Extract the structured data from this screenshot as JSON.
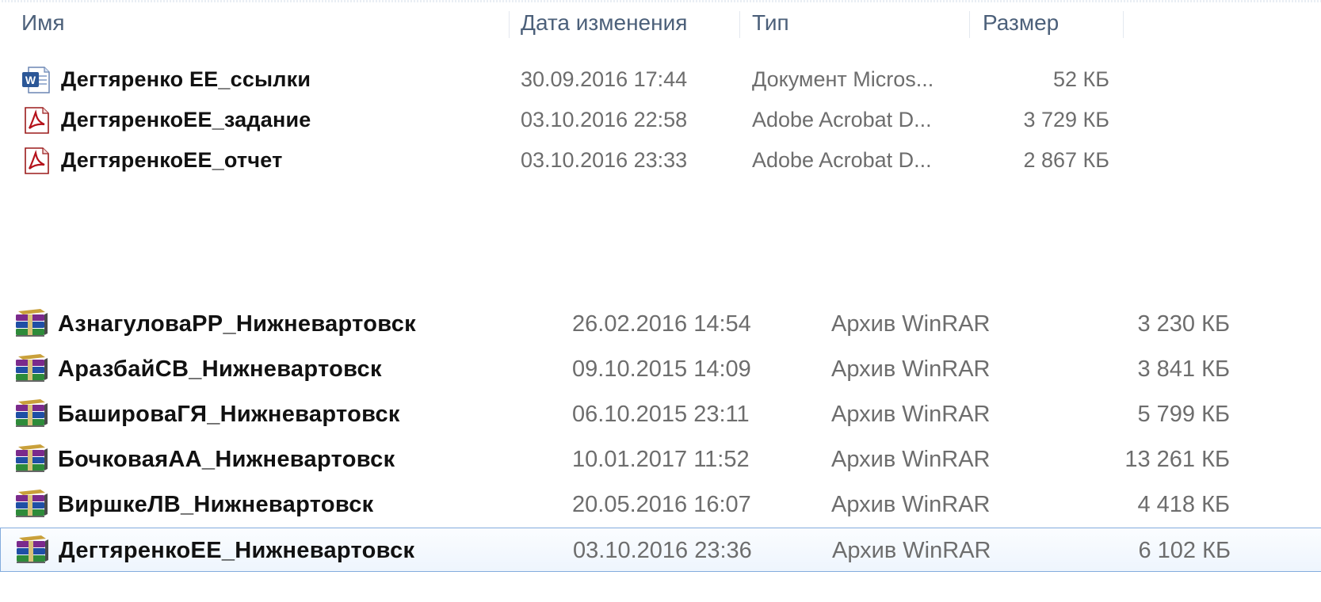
{
  "columns": {
    "name": "Имя",
    "date": "Дата изменения",
    "type": "Тип",
    "size": "Размер"
  },
  "top_files": [
    {
      "icon": "word-doc-icon",
      "name": "Дегтяренко ЕЕ_ссылки",
      "date": "30.09.2016 17:44",
      "type": "Документ Micros...",
      "size": "52 КБ"
    },
    {
      "icon": "pdf-icon",
      "name": "ДегтяренкоЕЕ_задание",
      "date": "03.10.2016 22:58",
      "type": "Adobe Acrobat D...",
      "size": "3 729 КБ"
    },
    {
      "icon": "pdf-icon",
      "name": "ДегтяренкоЕЕ_отчет",
      "date": "03.10.2016 23:33",
      "type": "Adobe Acrobat D...",
      "size": "2 867 КБ"
    }
  ],
  "archives": [
    {
      "icon": "winrar-archive-icon",
      "name": "АзнагуловаРР_Нижневартовск",
      "date": "26.02.2016 14:54",
      "type": "Архив WinRAR",
      "size": "3 230 КБ",
      "selected": false
    },
    {
      "icon": "winrar-archive-icon",
      "name": "АразбайСВ_Нижневартовск",
      "date": "09.10.2015 14:09",
      "type": "Архив WinRAR",
      "size": "3 841 КБ",
      "selected": false
    },
    {
      "icon": "winrar-archive-icon",
      "name": "БашироваГЯ_Нижневартовск",
      "date": "06.10.2015 23:11",
      "type": "Архив WinRAR",
      "size": "5 799 КБ",
      "selected": false
    },
    {
      "icon": "winrar-archive-icon",
      "name": "БочковаяАА_Нижневартовск",
      "date": "10.01.2017 11:52",
      "type": "Архив WinRAR",
      "size": "13 261 КБ",
      "selected": false
    },
    {
      "icon": "winrar-archive-icon",
      "name": "ВиршкеЛВ_Нижневартовск",
      "date": "20.05.2016 16:07",
      "type": "Архив WinRAR",
      "size": "4 418 КБ",
      "selected": false
    },
    {
      "icon": "winrar-archive-icon",
      "name": "ДегтяренкоЕЕ_Нижневартовск",
      "date": "03.10.2016 23:36",
      "type": "Архив WinRAR",
      "size": "6 102 КБ",
      "selected": true
    }
  ],
  "colors": {
    "header_text": "#4c607a",
    "selection_border": "#84acdd",
    "pdf_red": "#b5121b",
    "word_blue": "#2b5797"
  }
}
